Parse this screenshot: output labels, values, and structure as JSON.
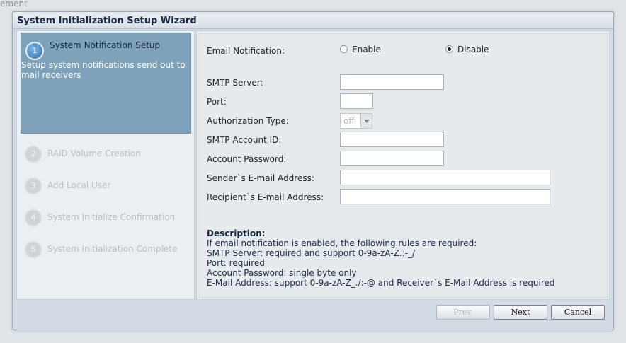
{
  "background_text": "ement",
  "window": {
    "title": "System Initialization Setup Wizard"
  },
  "steps": [
    {
      "number": "1",
      "label": "System Notification Setup",
      "active": true,
      "description": " Setup system notifications send out to mail receivers"
    },
    {
      "number": "2",
      "label": "RAID Volume Creation",
      "active": false
    },
    {
      "number": "3",
      "label": "Add Local User",
      "active": false
    },
    {
      "number": "4",
      "label": "System Initialize Confirmation",
      "active": false
    },
    {
      "number": "5",
      "label": "System Initialization Complete",
      "active": false
    }
  ],
  "form": {
    "email_notification": {
      "label": "Email Notification:",
      "options": [
        "Enable",
        "Disable"
      ],
      "selected": "Disable"
    },
    "smtp_server": {
      "label": "SMTP Server:",
      "value": ""
    },
    "port": {
      "label": "Port:",
      "value": ""
    },
    "auth_type": {
      "label": "Authorization Type:",
      "value": "off"
    },
    "smtp_account_id": {
      "label": "SMTP Account ID:",
      "value": ""
    },
    "account_password": {
      "label": "Account Password:",
      "value": ""
    },
    "sender_email": {
      "label": "Sender`s E-mail Address:",
      "value": ""
    },
    "recipient_email": {
      "label": "Recipient`s E-mail Address:",
      "value": ""
    }
  },
  "description": {
    "title": "Description:",
    "lines": [
      "If email notification is enabled, the following rules are required:",
      "SMTP Server: required and support 0-9a-zA-Z.:-_/",
      "Port: required",
      "Account Password: single byte only",
      "E-Mail Address: support 0-9a-zA-Z_./:-@ and Receiver`s E-Mail Address is required"
    ]
  },
  "buttons": {
    "prev": "Prev.",
    "next": "Next",
    "cancel": "Cancel"
  }
}
